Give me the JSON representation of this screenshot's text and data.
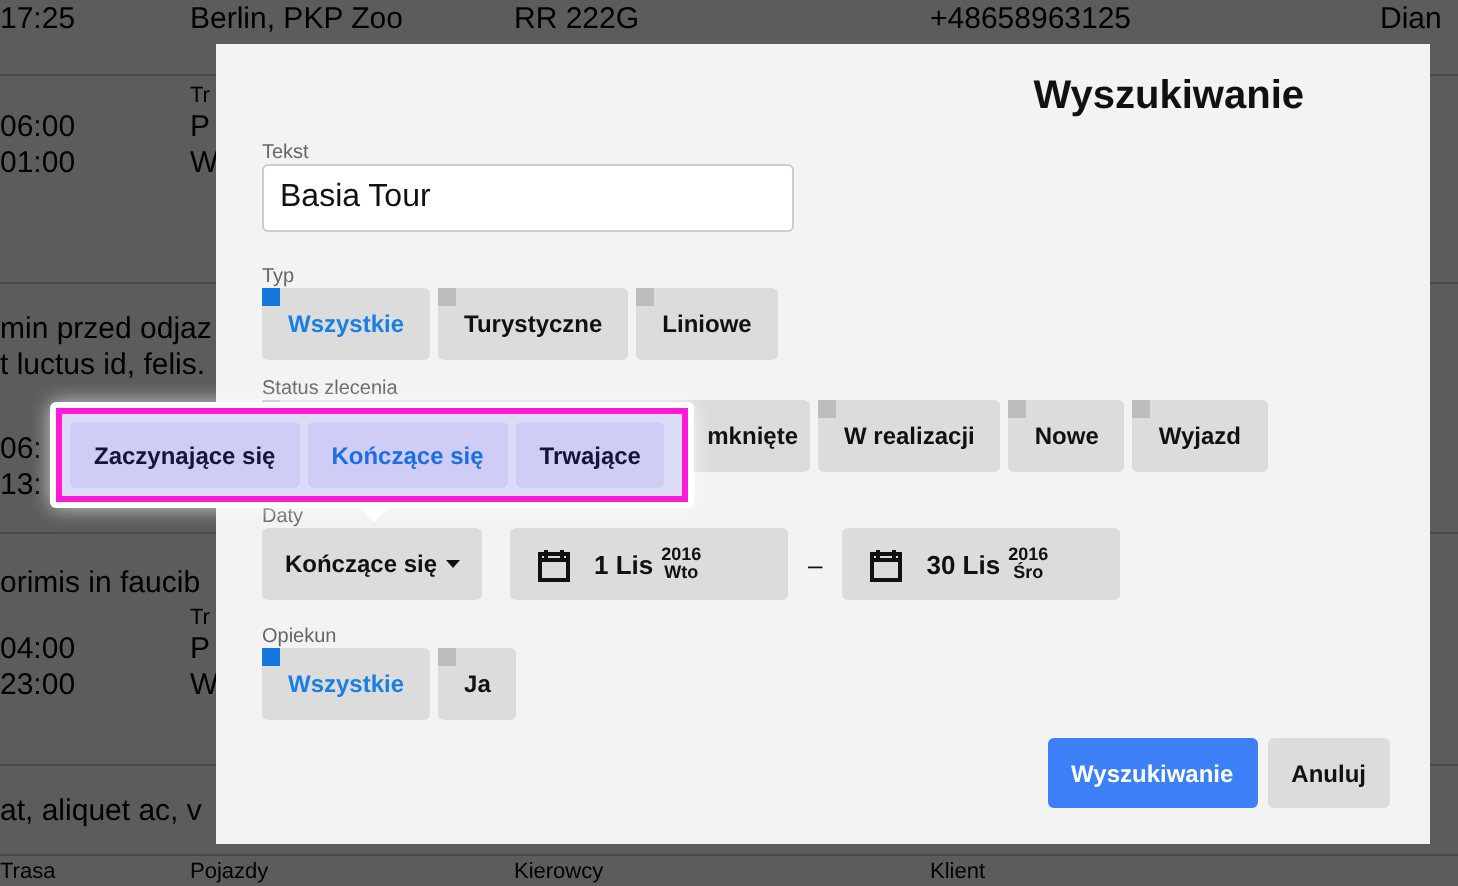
{
  "backdrop": {
    "header_row": [
      "17:25",
      "Berlin, PKP Zoo",
      "RR 222G",
      "+48658963125",
      "Dian"
    ],
    "items": [
      {
        "kind": "trip",
        "label": "Tr",
        "times": [
          "06:00",
          "01:00"
        ],
        "route": [
          "P",
          "W"
        ]
      },
      {
        "kind": "note",
        "lines": [
          "min przed odjaz",
          "t luctus id, felis."
        ]
      },
      {
        "kind": "trip",
        "times": [
          "06:",
          "13:"
        ]
      },
      {
        "kind": "note",
        "lines": [
          "orimis in faucib"
        ]
      },
      {
        "kind": "trip",
        "label": "Tr",
        "times": [
          "04:00",
          "23:00"
        ],
        "route": [
          "P",
          "W"
        ]
      },
      {
        "kind": "note",
        "lines": [
          "at, aliquet ac, v"
        ]
      }
    ],
    "footer_labels": [
      "Trasa",
      "Pojazdy",
      "Kierowcy",
      "Klient"
    ]
  },
  "dialog": {
    "title": "Wyszukiwanie",
    "text_field": {
      "label": "Tekst",
      "value": "Basia Tour"
    },
    "type": {
      "label": "Typ",
      "options": [
        {
          "label": "Wszystkie",
          "selected": true
        },
        {
          "label": "Turystyczne",
          "selected": false
        },
        {
          "label": "Liniowe",
          "selected": false
        }
      ]
    },
    "status": {
      "label": "Status zlecenia",
      "options": [
        {
          "label": "mknięte",
          "selected": false
        },
        {
          "label": "W realizacji",
          "selected": false
        },
        {
          "label": "Nowe",
          "selected": false
        },
        {
          "label": "Wyjazd",
          "selected": false
        }
      ]
    },
    "dates": {
      "label": "Daty",
      "mode": "Kończące się",
      "separator": "–",
      "from": {
        "day": "1 Lis",
        "year": "2016",
        "weekday": "Wto"
      },
      "to": {
        "day": "30 Lis",
        "year": "2016",
        "weekday": "Śro"
      }
    },
    "guardian": {
      "label": "Opiekun",
      "options": [
        {
          "label": "Wszystkie",
          "selected": true
        },
        {
          "label": "Ja",
          "selected": false
        }
      ]
    },
    "buttons": [
      {
        "label": "Wyszukiwanie",
        "kind": "primary"
      },
      {
        "label": "Anuluj",
        "kind": "secondary"
      }
    ]
  },
  "date_mode_popover": {
    "options": [
      {
        "label": "Zaczynające się",
        "selected": false
      },
      {
        "label": "Kończące się",
        "selected": true
      },
      {
        "label": "Trwające",
        "selected": false
      }
    ]
  }
}
